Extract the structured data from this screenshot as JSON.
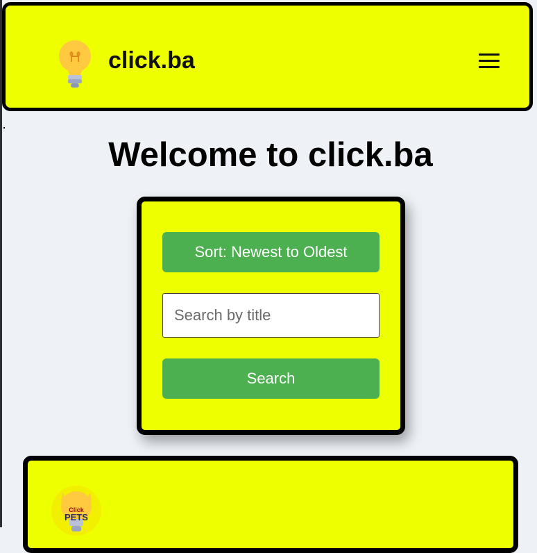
{
  "header": {
    "brand": "click.ba",
    "logo_icon": "lightbulb-icon",
    "menu_icon": "hamburger-menu-icon"
  },
  "main": {
    "title": "Welcome to click.ba",
    "controls": {
      "sort_label": "Sort: Newest to Oldest",
      "search_placeholder": "Search by title",
      "search_value": "",
      "search_button_label": "Search"
    },
    "post": {
      "logo_icon": "click-pets-logo-icon",
      "logo_text": [
        "Click",
        "PETS"
      ]
    }
  },
  "colors": {
    "accent_yellow": "#eeff00",
    "button_green": "#4caf50",
    "page_background": "#eef2f7",
    "border": "#000000"
  }
}
